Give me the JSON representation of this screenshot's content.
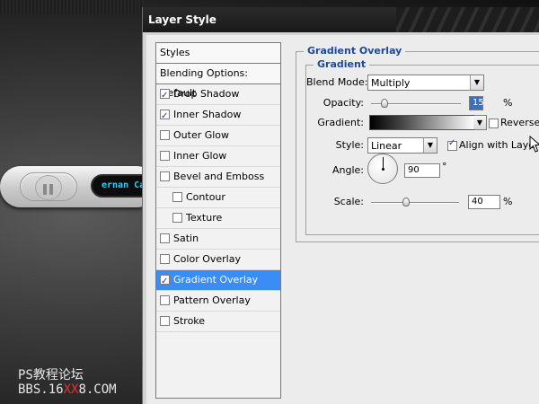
{
  "background": {
    "track_text": "ernan Catt",
    "watermark_line1": "PS教程论坛",
    "watermark_line2_a": "BBS.16",
    "watermark_line2_b": "XX",
    "watermark_line2_c": "8.COM"
  },
  "dialog": {
    "title": "Layer Style",
    "styles_header": "Styles",
    "blending_options": "Blending Options: Default",
    "items": [
      {
        "label": "Drop Shadow",
        "checked": true,
        "sub": false,
        "selected": false
      },
      {
        "label": "Inner Shadow",
        "checked": true,
        "sub": false,
        "selected": false
      },
      {
        "label": "Outer Glow",
        "checked": false,
        "sub": false,
        "selected": false
      },
      {
        "label": "Inner Glow",
        "checked": false,
        "sub": false,
        "selected": false
      },
      {
        "label": "Bevel and Emboss",
        "checked": false,
        "sub": false,
        "selected": false
      },
      {
        "label": "Contour",
        "checked": false,
        "sub": true,
        "selected": false
      },
      {
        "label": "Texture",
        "checked": false,
        "sub": true,
        "selected": false
      },
      {
        "label": "Satin",
        "checked": false,
        "sub": false,
        "selected": false
      },
      {
        "label": "Color Overlay",
        "checked": false,
        "sub": false,
        "selected": false
      },
      {
        "label": "Gradient Overlay",
        "checked": true,
        "sub": false,
        "selected": true
      },
      {
        "label": "Pattern Overlay",
        "checked": false,
        "sub": false,
        "selected": false
      },
      {
        "label": "Stroke",
        "checked": false,
        "sub": false,
        "selected": false
      }
    ]
  },
  "gradient_overlay": {
    "group_title": "Gradient Overlay",
    "sub_title": "Gradient",
    "blend_mode_label": "Blend Mode:",
    "blend_mode_value": "Multiply",
    "opacity_label": "Opacity:",
    "opacity_value": "15",
    "opacity_fraction": 0.15,
    "percent": "%",
    "gradient_label": "Gradient:",
    "reverse_label": "Reverse",
    "reverse_checked": false,
    "style_label": "Style:",
    "style_value": "Linear",
    "align_label": "Align with Layer",
    "align_checked": true,
    "angle_label": "Angle:",
    "angle_value": "90",
    "degree": "°",
    "scale_label": "Scale:",
    "scale_value": "40",
    "scale_fraction": 0.4
  },
  "colors": {
    "selection": "#3b8cf5",
    "section_title": "#1a4a9a",
    "title_bar": "#1a1a1a",
    "track_text": "#35c9ff"
  }
}
